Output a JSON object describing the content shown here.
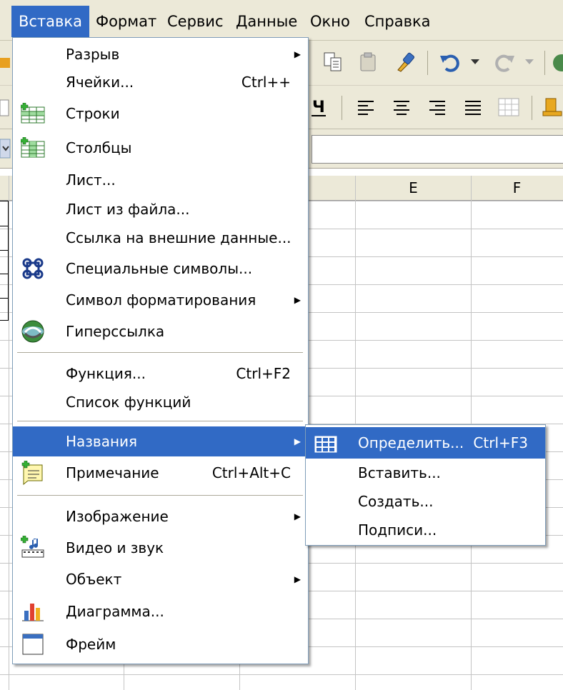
{
  "menubar": {
    "items": [
      "Вставка",
      "Формат",
      "Сервис",
      "Данные",
      "Окно",
      "Справка"
    ],
    "active": "Вставка"
  },
  "sheet": {
    "columns": [
      "E",
      "F"
    ]
  },
  "insert_menu": {
    "items": [
      {
        "label": "Разрыв",
        "shortcut": "",
        "submenu": true,
        "icon": ""
      },
      {
        "label": "Ячейки...",
        "shortcut": "Ctrl++",
        "submenu": false,
        "icon": ""
      },
      {
        "label": "Строки",
        "shortcut": "",
        "submenu": false,
        "icon": "insert-rows-icon"
      },
      {
        "label": "Столбцы",
        "shortcut": "",
        "submenu": false,
        "icon": "insert-columns-icon"
      },
      {
        "label": "Лист...",
        "shortcut": "",
        "submenu": false,
        "icon": ""
      },
      {
        "label": "Лист из файла...",
        "shortcut": "",
        "submenu": false,
        "icon": ""
      },
      {
        "label": "Ссылка на внешние данные...",
        "shortcut": "",
        "submenu": false,
        "icon": ""
      },
      {
        "label": "Специальные символы...",
        "shortcut": "",
        "submenu": false,
        "icon": "special-character-icon"
      },
      {
        "label": "Символ форматирования",
        "shortcut": "",
        "submenu": true,
        "icon": ""
      },
      {
        "label": "Гиперссылка",
        "shortcut": "",
        "submenu": false,
        "icon": "hyperlink-icon"
      },
      {
        "label": "Функция...",
        "shortcut": "Ctrl+F2",
        "submenu": false,
        "icon": ""
      },
      {
        "label": "Список функций",
        "shortcut": "",
        "submenu": false,
        "icon": ""
      },
      {
        "label": "Названия",
        "shortcut": "",
        "submenu": true,
        "icon": "",
        "highlighted": true
      },
      {
        "label": "Примечание",
        "shortcut": "Ctrl+Alt+C",
        "submenu": false,
        "icon": "note-icon"
      },
      {
        "label": "Изображение",
        "shortcut": "",
        "submenu": true,
        "icon": ""
      },
      {
        "label": "Видео и звук",
        "shortcut": "",
        "submenu": false,
        "icon": "media-icon"
      },
      {
        "label": "Объект",
        "shortcut": "",
        "submenu": true,
        "icon": ""
      },
      {
        "label": "Диаграмма...",
        "shortcut": "",
        "submenu": false,
        "icon": "chart-icon"
      },
      {
        "label": "Фрейм",
        "shortcut": "",
        "submenu": false,
        "icon": "frame-icon"
      }
    ]
  },
  "names_submenu": {
    "items": [
      {
        "label": "Определить...",
        "shortcut": "Ctrl+F3",
        "highlighted": true,
        "icon": "define-names-icon"
      },
      {
        "label": "Вставить...",
        "shortcut": ""
      },
      {
        "label": "Создать...",
        "shortcut": ""
      },
      {
        "label": "Подписи...",
        "shortcut": ""
      }
    ]
  },
  "colors": {
    "highlight": "#316ac5",
    "menubar_bg": "#ece9d8",
    "menu_border": "#7f9db9"
  }
}
